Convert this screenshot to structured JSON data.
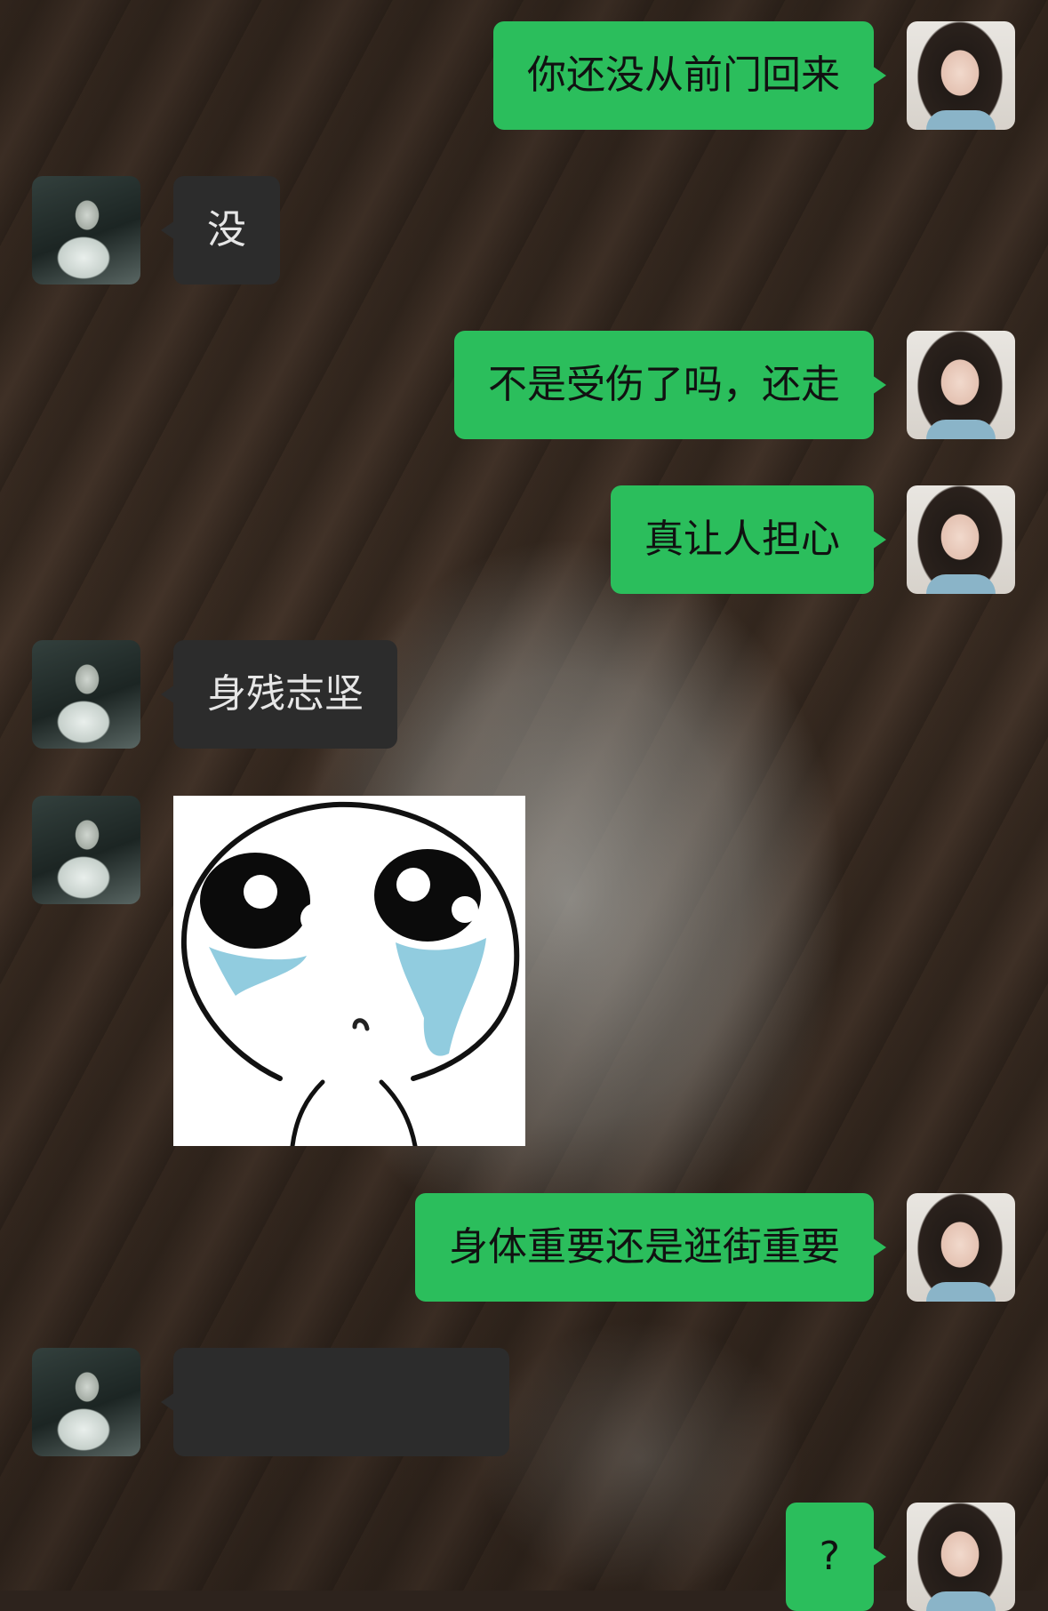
{
  "chat": {
    "messages": [
      {
        "sender": "me",
        "type": "text",
        "text": "你还没从前门回来"
      },
      {
        "sender": "other",
        "type": "text",
        "text": "没"
      },
      {
        "sender": "me",
        "type": "text",
        "text": "不是受伤了吗，还走"
      },
      {
        "sender": "me",
        "type": "text",
        "text": "真让人担心"
      },
      {
        "sender": "other",
        "type": "text",
        "text": "身残志坚"
      },
      {
        "sender": "other",
        "type": "sticker",
        "sticker": "crying-face-sticker"
      },
      {
        "sender": "me",
        "type": "text",
        "text": "身体重要还是逛街重要"
      },
      {
        "sender": "other",
        "type": "text",
        "text": "",
        "obscured": true
      },
      {
        "sender": "me",
        "type": "text",
        "text": "?"
      }
    ]
  },
  "colors": {
    "me_bubble": "#2bbe5c",
    "other_bubble": "#2c2c2c",
    "me_text": "#111111",
    "other_text": "#e6e6e6"
  }
}
